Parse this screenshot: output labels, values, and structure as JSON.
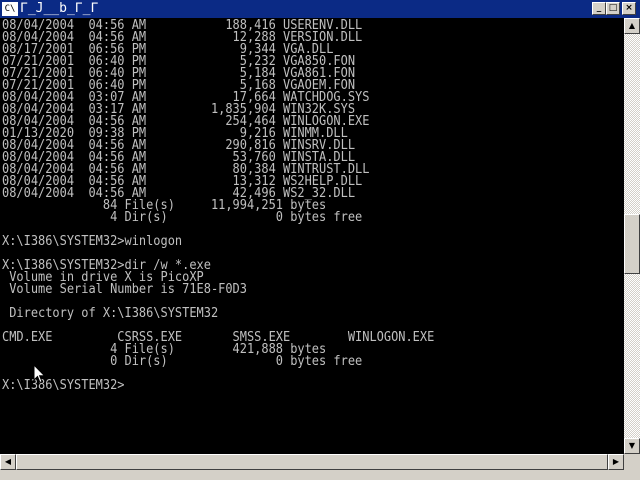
{
  "window": {
    "title_icon": "C\\",
    "title": "Γ_J__b_Γ_Γ"
  },
  "icons": {
    "app": "console-icon",
    "minimize": "minimize-icon",
    "maximize": "maximize-icon",
    "close": "close-icon",
    "cursor": "mouse-pointer-icon"
  },
  "console": {
    "lines": [
      "08/04/2004  04:56 AM           188,416 USERENV.DLL",
      "08/04/2004  04:56 AM            12,288 VERSION.DLL",
      "08/17/2001  06:56 PM             9,344 VGA.DLL",
      "07/21/2001  06:40 PM             5,232 VGA850.FON",
      "07/21/2001  06:40 PM             5,184 VGA861.FON",
      "07/21/2001  06:40 PM             5,168 VGAOEM.FON",
      "08/04/2004  03:07 AM            17,664 WATCHDOG.SYS",
      "08/04/2004  03:17 AM         1,835,904 WIN32K.SYS",
      "08/04/2004  04:56 AM           254,464 WINLOGON.EXE",
      "01/13/2020  09:38 PM             9,216 WINMM.DLL",
      "08/04/2004  04:56 AM           290,816 WINSRV.DLL",
      "08/04/2004  04:56 AM            53,760 WINSTA.DLL",
      "08/04/2004  04:56 AM            80,384 WINTRUST.DLL",
      "08/04/2004  04:56 AM            13,312 WS2HELP.DLL",
      "08/04/2004  04:56 AM            42,496 WS2_32.DLL",
      "              84 File(s)     11,994,251 bytes",
      "               4 Dir(s)               0 bytes free",
      "",
      "X:\\I386\\SYSTEM32>winlogon",
      "",
      "X:\\I386\\SYSTEM32>dir /w *.exe",
      " Volume in drive X is PicoXP",
      " Volume Serial Number is 71E8-F0D3",
      "",
      " Directory of X:\\I386\\SYSTEM32",
      "",
      "CMD.EXE         CSRSS.EXE       SMSS.EXE        WINLOGON.EXE",
      "               4 File(s)        421,888 bytes",
      "               0 Dir(s)               0 bytes free",
      "",
      "X:\\I386\\SYSTEM32>"
    ]
  },
  "scrollbars": {
    "up": "▲",
    "down": "▼",
    "left": "◀",
    "right": "▶"
  },
  "colors": {
    "titlebar": "#0b2a85",
    "console_bg": "#000000",
    "console_text": "#c0c0c0",
    "chrome": "#d4d0c8"
  }
}
